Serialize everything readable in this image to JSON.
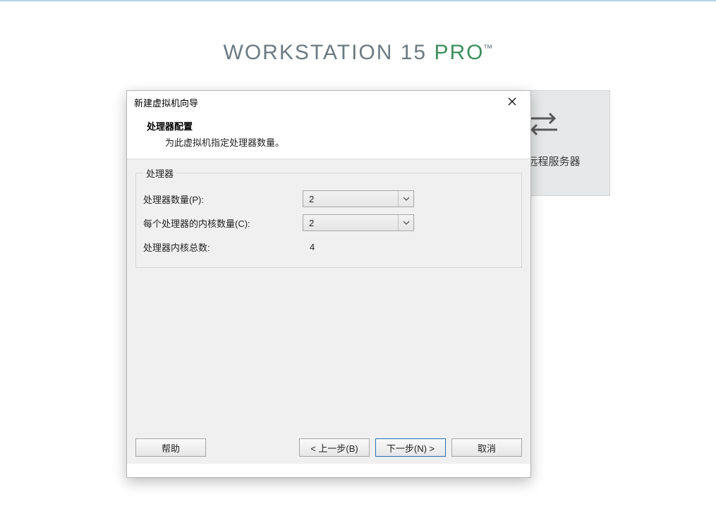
{
  "brand": {
    "pre": "WORKSTATION 15 ",
    "accent": "PRO",
    "tm": "™"
  },
  "homeTile": {
    "label": "连接远程服务器"
  },
  "dialog": {
    "title": "新建虚拟机向导",
    "heading": "处理器配置",
    "subheading": "为此虚拟机指定处理器数量。",
    "groupLabel": "处理器",
    "fields": {
      "processorCountLabel": "处理器数量(P):",
      "processorCountValue": "2",
      "coresPerProcessorLabel": "每个处理器的内核数量(C):",
      "coresPerProcessorValue": "2",
      "totalCoresLabel": "处理器内核总数:",
      "totalCoresValue": "4"
    },
    "buttons": {
      "help": "帮助",
      "back": "< 上一步(B)",
      "next": "下一步(N) >",
      "cancel": "取消"
    }
  }
}
